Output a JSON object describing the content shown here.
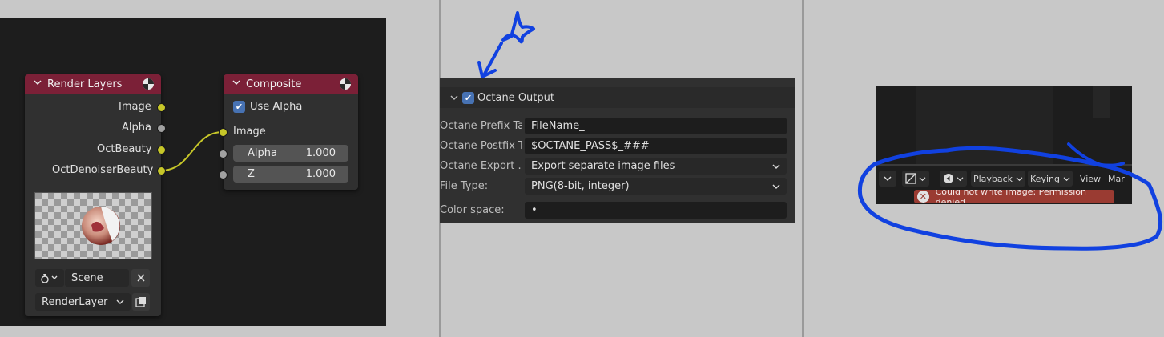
{
  "node_editor": {
    "render_layers_node": {
      "title": "Render Layers",
      "outputs": [
        "Image",
        "Alpha",
        "OctBeauty",
        "OctDenoiserBeauty"
      ],
      "scene_value": "Scene",
      "layer_value": "RenderLayer"
    },
    "composite_node": {
      "title": "Composite",
      "use_alpha_label": "Use Alpha",
      "input_image_label": "Image",
      "alpha_label": "Alpha",
      "alpha_value": "1.000",
      "z_label": "Z",
      "z_value": "1.000"
    }
  },
  "octane_output": {
    "header_label": "Octane Output",
    "rows": [
      {
        "label": "Octane Prefix Ta...",
        "value": "FileName_"
      },
      {
        "label": "Octane Postfix T...",
        "value": "$OCTANE_PASS$_###"
      },
      {
        "label": "Octane Export ...",
        "value": "Export separate image files"
      },
      {
        "label": "File Type:",
        "value": "PNG(8-bit, integer)"
      },
      {
        "label": "Color space:",
        "value": "•"
      }
    ]
  },
  "timeline": {
    "buttons": [
      "Playback",
      "Keying",
      "View",
      "Mar"
    ],
    "error_message": "Could not write image: Permission denied"
  },
  "colors": {
    "annotation": "#1141e0",
    "node_header": "#7b2037",
    "socket_color": "#c7c729",
    "error_bg": "#9a3b32",
    "checkbox": "#4772b3"
  }
}
